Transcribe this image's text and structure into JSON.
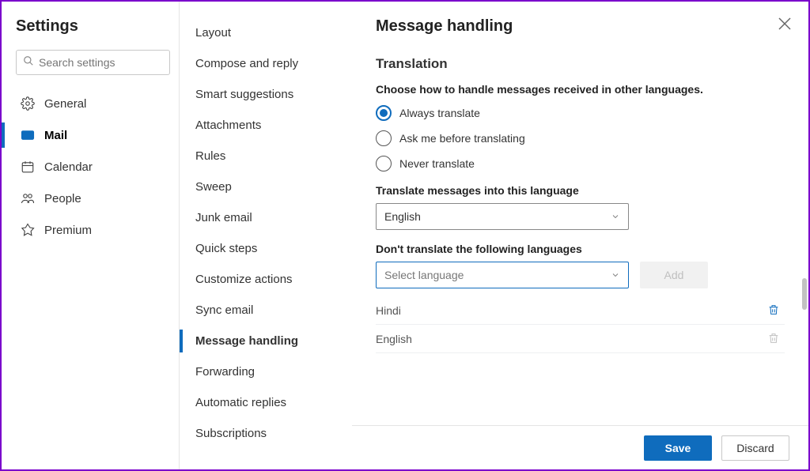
{
  "title": "Settings",
  "search": {
    "placeholder": "Search settings"
  },
  "nav": {
    "general": "General",
    "mail": "Mail",
    "calendar": "Calendar",
    "people": "People",
    "premium": "Premium"
  },
  "sub": {
    "layout": "Layout",
    "compose": "Compose and reply",
    "smart": "Smart suggestions",
    "attachments": "Attachments",
    "rules": "Rules",
    "sweep": "Sweep",
    "junk": "Junk email",
    "quick": "Quick steps",
    "customize": "Customize actions",
    "sync": "Sync email",
    "message_handling": "Message handling",
    "forwarding": "Forwarding",
    "automatic": "Automatic replies",
    "subscriptions": "Subscriptions"
  },
  "pane": {
    "title": "Message handling",
    "section": "Translation",
    "choose": "Choose how to handle messages received in other languages.",
    "radio_always": "Always translate",
    "radio_ask": "Ask me before translating",
    "radio_never": "Never translate",
    "into_label": "Translate messages into this language",
    "into_value": "English",
    "dont_label": "Don't translate the following languages",
    "dont_placeholder": "Select language",
    "add": "Add",
    "excluded": {
      "0": "Hindi",
      "1": "English"
    },
    "save": "Save",
    "discard": "Discard"
  }
}
